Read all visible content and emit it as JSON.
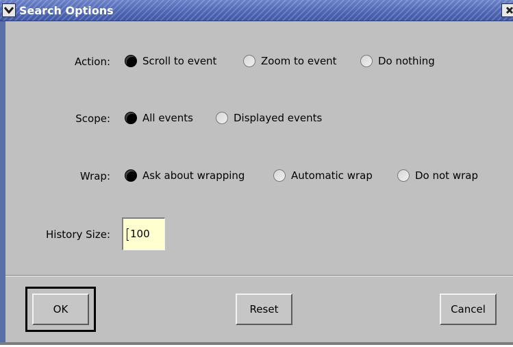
{
  "window": {
    "title": "Search Options",
    "menu_icon": "chevron-down-icon",
    "close_icon": "close-icon"
  },
  "rows": {
    "action": {
      "label": "Action:",
      "options": [
        "Scroll to event",
        "Zoom to event",
        "Do nothing"
      ],
      "selected": "Scroll to event"
    },
    "scope": {
      "label": "Scope:",
      "options": [
        "All events",
        "Displayed events"
      ],
      "selected": "All events"
    },
    "wrap": {
      "label": "Wrap:",
      "options": [
        "Ask about wrapping",
        "Automatic wrap",
        "Do not wrap"
      ],
      "selected": "Ask about wrapping"
    },
    "history": {
      "label": "History Size:",
      "value": "100"
    }
  },
  "buttons": {
    "ok": "OK",
    "reset": "Reset",
    "cancel": "Cancel"
  },
  "colors": {
    "titlebar": "#4e66b4",
    "background": "#c0c0c0",
    "input_bg": "#ffffd0"
  }
}
